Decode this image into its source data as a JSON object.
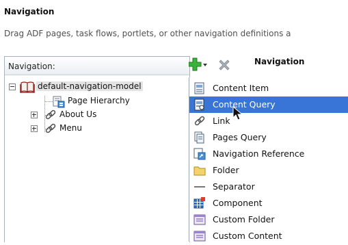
{
  "heading": "Navigation",
  "description": "Drag ADF pages, task flows, portlets, or other navigation definitions a",
  "left_panel": {
    "title": "Navigation:",
    "tree": [
      {
        "label": "default-navigation-model",
        "icon": "book-icon",
        "expander": "minus",
        "selected": true
      },
      {
        "label": "Page Hierarchy",
        "icon": "page-hierarchy-icon"
      },
      {
        "label": "About Us",
        "icon": "link-icon",
        "expander": "plus"
      },
      {
        "label": "Menu",
        "icon": "link-icon",
        "expander": "plus"
      }
    ]
  },
  "toolbar": {
    "add_icon": "green-plus-icon",
    "delete_icon": "gray-x-icon"
  },
  "right_panel": {
    "title": "Navigation"
  },
  "menu": {
    "items": [
      {
        "label": "Content Item",
        "icon": "content-item-icon"
      },
      {
        "label": "Content Query",
        "icon": "content-query-icon",
        "selected": true
      },
      {
        "label": "Link",
        "icon": "link-icon"
      },
      {
        "label": "Pages Query",
        "icon": "pages-query-icon"
      },
      {
        "label": "Navigation Reference",
        "icon": "navigation-reference-icon"
      },
      {
        "label": "Folder",
        "icon": "folder-icon"
      },
      {
        "label": "Separator",
        "icon": "separator-icon"
      },
      {
        "label": "Component",
        "icon": "component-icon"
      },
      {
        "label": "Custom Folder",
        "icon": "custom-folder-icon"
      },
      {
        "label": "Custom Content",
        "icon": "custom-content-icon"
      }
    ]
  },
  "colors": {
    "selection": "#3875d7",
    "tree_selection": "#e3e3e3",
    "panel_border": "#a8b2bf",
    "add_green": "#3bb33b"
  }
}
